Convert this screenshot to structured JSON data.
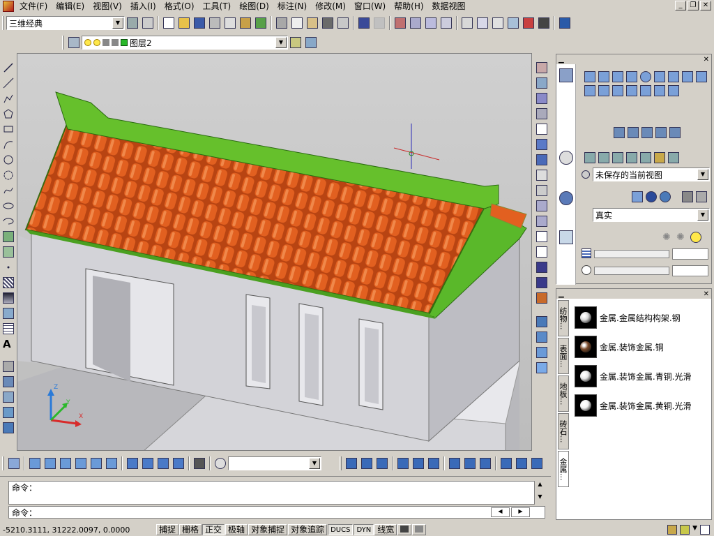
{
  "menubar": {
    "items": [
      "文件(F)",
      "编辑(E)",
      "视图(V)",
      "插入(I)",
      "格式(O)",
      "工具(T)",
      "绘图(D)",
      "标注(N)",
      "修改(M)",
      "窗口(W)",
      "帮助(H)",
      "数据视图"
    ]
  },
  "workspace": {
    "value": "三维经典"
  },
  "layer": {
    "value": "图层2"
  },
  "render_panel": {
    "view_combo": "未保存的当前视图",
    "visual_style_combo": "真实"
  },
  "materials": {
    "tabs": [
      "纺物...",
      "表面...",
      "地板...",
      "砖石...",
      "金属..."
    ],
    "items": [
      {
        "label": "金属.金属结构构架.钢",
        "color": "#d8d8d8"
      },
      {
        "label": "金属.装饰金属.铜",
        "color": "#7a4a2a"
      },
      {
        "label": "金属.装饰金属.青铜.光滑",
        "color": "#e8e8e8"
      },
      {
        "label": "金属.装饰金属.黄铜.光滑",
        "color": "#f4f4f4"
      }
    ]
  },
  "command": {
    "line1": "命令：",
    "line2": "命令："
  },
  "status": {
    "coords": "-5210.3111, 31222.0097, 0.0000",
    "buttons": [
      {
        "label": "捕捉",
        "on": false
      },
      {
        "label": "栅格",
        "on": false
      },
      {
        "label": "正交",
        "on": true
      },
      {
        "label": "极轴",
        "on": false
      },
      {
        "label": "对象捕捉",
        "on": false
      },
      {
        "label": "对象追踪",
        "on": false
      },
      {
        "label": "DUCS",
        "on": true
      },
      {
        "label": "DYN",
        "on": true
      },
      {
        "label": "线宽",
        "on": false
      }
    ]
  },
  "colors": {
    "roof_tile": "#d4561e",
    "roof_ridge": "#6cc82c",
    "wall": "#d2d2d8",
    "viewport_bg": "#c6c6c6"
  }
}
